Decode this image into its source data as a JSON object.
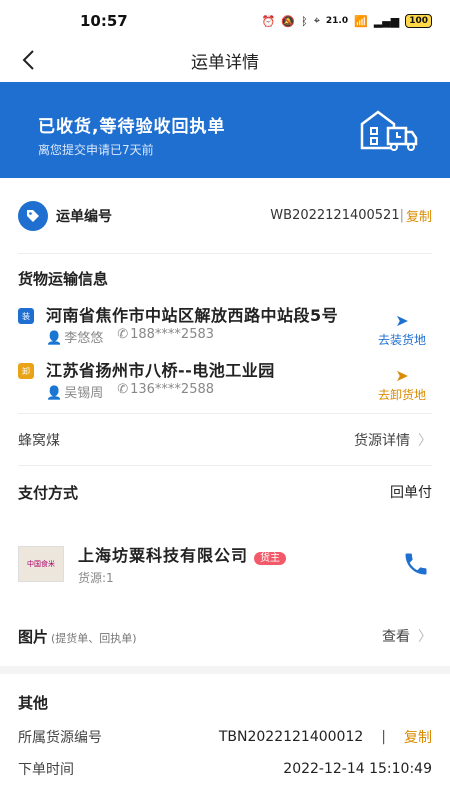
{
  "statusbar": {
    "time": "10:57",
    "net": "21.0",
    "battery": "100"
  },
  "nav": {
    "title": "运单详情"
  },
  "banner": {
    "status": "已收货,等待验收回执单",
    "sub": "离您提交申请已7天前"
  },
  "waybill": {
    "label": "运单编号",
    "number": "WB2022121400521",
    "sep": "|",
    "copy": "复制"
  },
  "goods": {
    "title": "货物运输信息",
    "load": {
      "badge": "装",
      "place": "河南省焦作市中站区解放西路中站段5号",
      "person": "李悠悠",
      "phone": "188****2583",
      "nav": "去装货地",
      "color": "#1f6fd0"
    },
    "unload": {
      "badge": "卸",
      "place": "江苏省扬州市八桥--电池工业园",
      "person": "吴锡周",
      "phone": "136****2588",
      "nav": "去卸货地",
      "color": "#e8a317"
    }
  },
  "cargo": {
    "name": "蜂窝煤",
    "link": "货源详情"
  },
  "payment": {
    "label": "支付方式",
    "value": "回单付"
  },
  "company": {
    "name": "上海坊粟科技有限公司",
    "tag": "货主",
    "source": "货源:1",
    "logo_text": "中国食米"
  },
  "pictures": {
    "label": "图片",
    "sub": "(提货单、回执单)",
    "link": "查看"
  },
  "other": {
    "title": "其他",
    "source_label": "所属货源编号",
    "source_no": "TBN2022121400012",
    "sep": "|",
    "copy": "复制",
    "time_label": "下单时间",
    "time": "2022-12-14 15:10:49"
  },
  "colors": {
    "primary": "#1f6fd0",
    "accent": "#d98b00",
    "owner_tag": "#f25a6a"
  }
}
